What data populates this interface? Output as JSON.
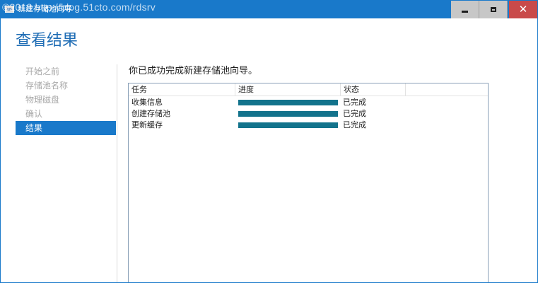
{
  "window": {
    "title": "新建存储池向导",
    "watermark": "©2018 http://blog.51cto.com/rdsrv",
    "close_glyph": "✕"
  },
  "page": {
    "title": "查看结果"
  },
  "nav": {
    "items": [
      {
        "label": "开始之前",
        "active": false
      },
      {
        "label": "存储池名称",
        "active": false
      },
      {
        "label": "物理磁盘",
        "active": false
      },
      {
        "label": "确认",
        "active": false
      },
      {
        "label": "结果",
        "active": true
      }
    ]
  },
  "main": {
    "heading": "你已成功完成新建存储池向导。",
    "table": {
      "headers": {
        "task": "任务",
        "progress": "进度",
        "status": "状态"
      },
      "rows": [
        {
          "task": "收集信息",
          "progress": 100,
          "status": "已完成"
        },
        {
          "task": "创建存储池",
          "progress": 100,
          "status": "已完成"
        },
        {
          "task": "更新缓存",
          "progress": 100,
          "status": "已完成"
        }
      ]
    }
  },
  "colors": {
    "accent": "#1979ca",
    "title_text": "#1f6db5",
    "progress_fill": "#13738c",
    "close_button": "#c94a4a"
  }
}
